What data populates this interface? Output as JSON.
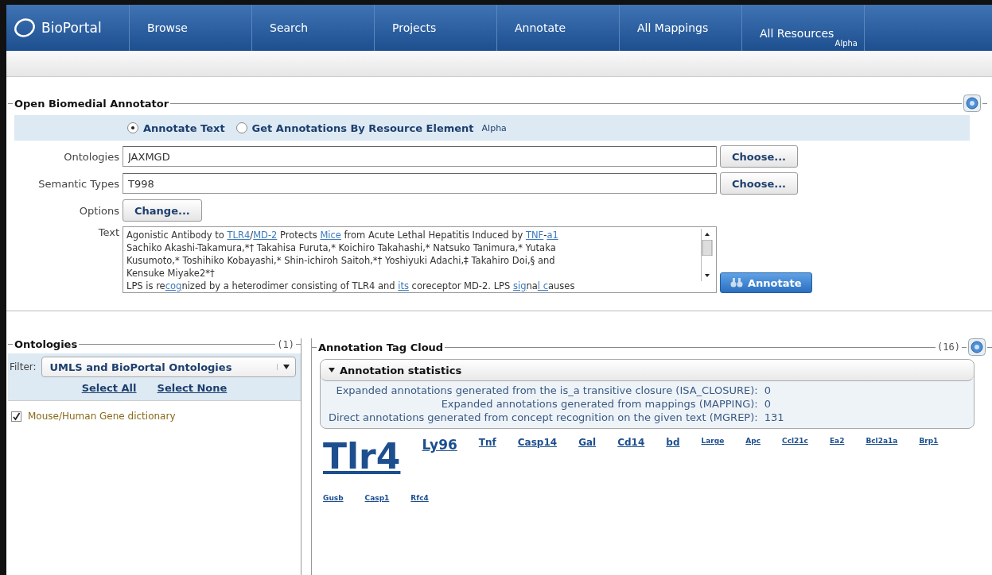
{
  "nav": {
    "logo": "BioPortal",
    "items": [
      {
        "label": "Browse",
        "selected": false
      },
      {
        "label": "Search",
        "selected": false
      },
      {
        "label": "Projects",
        "selected": false
      },
      {
        "label": "Annotate",
        "selected": false
      },
      {
        "label": "All Mappings",
        "selected": false
      },
      {
        "label": "All Resources",
        "badge": "Alpha",
        "selected": false
      }
    ]
  },
  "annotator": {
    "title": "Open Biomedial Annotator",
    "modes": [
      {
        "label": "Annotate Text",
        "selected": true
      },
      {
        "label": "Get Annotations By Resource Element",
        "badge": "Alpha",
        "selected": false
      }
    ],
    "fields": [
      {
        "label": "Ontologies",
        "value": "JAXMGD",
        "button": "Choose..."
      },
      {
        "label": "Semantic Types",
        "value": "T998",
        "button": "Choose..."
      }
    ],
    "options": {
      "label": "Options",
      "button": "Change..."
    },
    "text": {
      "label": "Text",
      "lines": [
        [
          {
            "t": "Agonistic Antibody to "
          },
          {
            "t": "TLR4",
            "link": true
          },
          {
            "t": "/"
          },
          {
            "t": "MD-2",
            "link": true
          },
          {
            "t": " Protects "
          },
          {
            "t": "Mice",
            "link": true
          },
          {
            "t": " from Acute Lethal Hepatitis Induced by "
          },
          {
            "t": "TNF",
            "link": true
          },
          {
            "t": "-"
          },
          {
            "t": "a1",
            "link": true
          }
        ],
        [
          {
            "t": "Sachiko Akashi-Takamura,*† Takahisa Furuta,* Koichiro Takahashi,* Natsuko Tanimura,* Yutaka"
          }
        ],
        [
          {
            "t": "Kusumoto,* Toshihiko Kobayashi,* Shin-ichiroh Saitoh,*† Yoshiyuki Adachi,‡ Takahiro Doi,§ and"
          }
        ],
        [
          {
            "t": "Kensuke Miyake2*†"
          }
        ],
        [
          {
            "t": "LPS is re"
          },
          {
            "t": "cog",
            "link": true
          },
          {
            "t": "nized by a heterodimer consisting of TLR4 and "
          },
          {
            "t": "its",
            "link": true
          },
          {
            "t": " coreceptor MD-2. LPS "
          },
          {
            "t": "sig",
            "link": true
          },
          {
            "t": "na"
          },
          {
            "t": "l c",
            "link": true
          },
          {
            "t": "auses"
          }
        ]
      ]
    },
    "submit": "Annotate"
  },
  "ontologies": {
    "title": "Ontologies",
    "count": "(1)",
    "filter_label": "Filter:",
    "filter_value": "UMLS and BioPortal Ontologies",
    "select_all": "Select All",
    "select_none": "Select None",
    "items": [
      {
        "label": "Mouse/Human Gene dictionary",
        "checked": true
      }
    ]
  },
  "cloud": {
    "title": "Annotation Tag Cloud",
    "count": "(16)",
    "stats_title": "Annotation statistics",
    "stats_expanded": true,
    "stats": [
      {
        "label": "Expanded annotations generated from the is_a transitive closure (ISA_CLOSURE):",
        "value": "0"
      },
      {
        "label": "Expanded annotations generated from mappings (MAPPING):",
        "value": "0"
      },
      {
        "label": "Direct annotations generated from concept recognition on the given text (MGREP):",
        "value": "131"
      }
    ],
    "tags": [
      {
        "label": "Tlr4",
        "kind": "huge"
      },
      {
        "label": "Ly96",
        "kind": "large"
      },
      {
        "label": "Tnf",
        "kind": "medium"
      },
      {
        "label": "Casp14",
        "kind": "medium"
      },
      {
        "label": "Gal",
        "kind": "medium"
      },
      {
        "label": "Cd14",
        "kind": "medium"
      },
      {
        "label": "bd",
        "kind": "medium"
      },
      {
        "label": "Large",
        "kind": "small"
      },
      {
        "label": "Apc",
        "kind": "small"
      },
      {
        "label": "Ccl21c",
        "kind": "small"
      },
      {
        "label": "Ea2",
        "kind": "small"
      },
      {
        "label": "Bcl2a1a",
        "kind": "small"
      },
      {
        "label": "Brp1",
        "kind": "small"
      },
      {
        "label": "Gusb",
        "kind": "small"
      },
      {
        "label": "Casp1",
        "kind": "small"
      },
      {
        "label": "Rfc4",
        "kind": "small"
      }
    ]
  }
}
